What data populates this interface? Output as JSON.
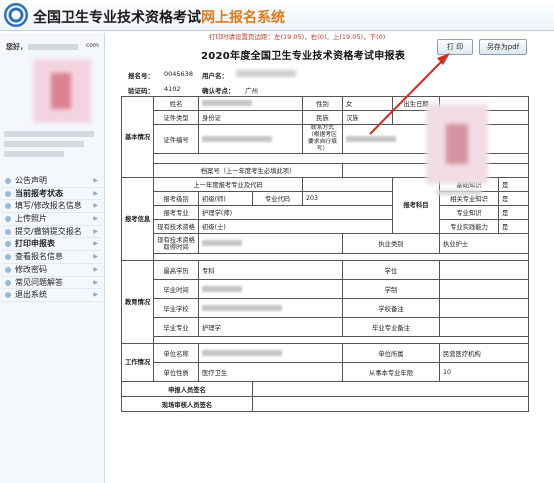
{
  "header": {
    "title_main": "全国卫生专业技术资格考试",
    "title_sub": "网上报名系统"
  },
  "sidebar": {
    "welcome": "您好，",
    "suffix": "com",
    "menu": [
      {
        "label": "公告声明"
      },
      {
        "label": "当前报考状态"
      },
      {
        "label": "填写/修改报名信息"
      },
      {
        "label": "上传照片"
      },
      {
        "label": "提交/撤销提交报名"
      },
      {
        "label": "打印申报表"
      },
      {
        "label": "查看报名信息"
      },
      {
        "label": "修改密码"
      },
      {
        "label": "常见问题解答"
      },
      {
        "label": "退出系统"
      }
    ]
  },
  "toolbar": {
    "notice": "打印时请设置页边距：左(19.05)，右(0)，上(19.05)，下(0)",
    "print_label": "打 印",
    "pdf_label": "另存为pdf"
  },
  "form": {
    "title": "2020年度全国卫生专业技术资格考试申报表",
    "reg_no_label": "报名号：",
    "reg_no": "0045638",
    "user_label": "用户名：",
    "verify_label": "验证码：",
    "verify_code": "4102",
    "site_label": "确认考点：",
    "site": "广州",
    "basic": {
      "section": "基本情况",
      "name_label": "姓名",
      "gender_label": "性别",
      "gender": "女",
      "birth_label": "出生日期",
      "id_type_label": "证件类型",
      "id_type": "身份证",
      "nation_label": "民族",
      "nation": "汉族",
      "id_no_label": "证件编号",
      "contact_label": "联系方式（根据考区要求自行填写）",
      "archive": "档案号（上一年度考生必填此项）"
    },
    "exam": {
      "section": "报考信息",
      "prev_code": "上一年度报考专业及代码",
      "level_label": "报考级别",
      "level": "初级(师)",
      "code_label": "专业代码",
      "code": "203",
      "major_label": "报考专业",
      "major": "护理学(师)",
      "current_label": "现有技术资格",
      "current": "初级(士)",
      "obtain_label": "现有技术资格取得时间",
      "practice_label": "执业类别",
      "practice": "执业护士"
    },
    "subjects": {
      "section": "报考科目",
      "items": [
        {
          "name": "基础知识",
          "value": "是"
        },
        {
          "name": "相关专业知识",
          "value": "是"
        },
        {
          "name": "专业知识",
          "value": "是"
        },
        {
          "name": "专业实践能力",
          "value": "是"
        }
      ]
    },
    "education": {
      "section": "教育情况",
      "highest_label": "最高学历",
      "highest": "专科",
      "degree_label": "学位",
      "grad_time_label": "毕业时间",
      "system_label": "学制",
      "school_label": "毕业学校",
      "school_note_label": "学校备注",
      "grad_major_label": "毕业专业",
      "grad_major": "护理学",
      "major_note_label": "毕业专业备注"
    },
    "work": {
      "section": "工作情况",
      "unit_label": "单位名称",
      "unit_owner_label": "单位所属",
      "unit_owner": "民营医疗机构",
      "unit_type_label": "单位性质",
      "unit_type": "医疗卫生",
      "years_label": "从事本专业年限",
      "years": "10"
    },
    "sign_applicant": "申报人员签名",
    "sign_reviewer": "现场审核人员签名"
  }
}
